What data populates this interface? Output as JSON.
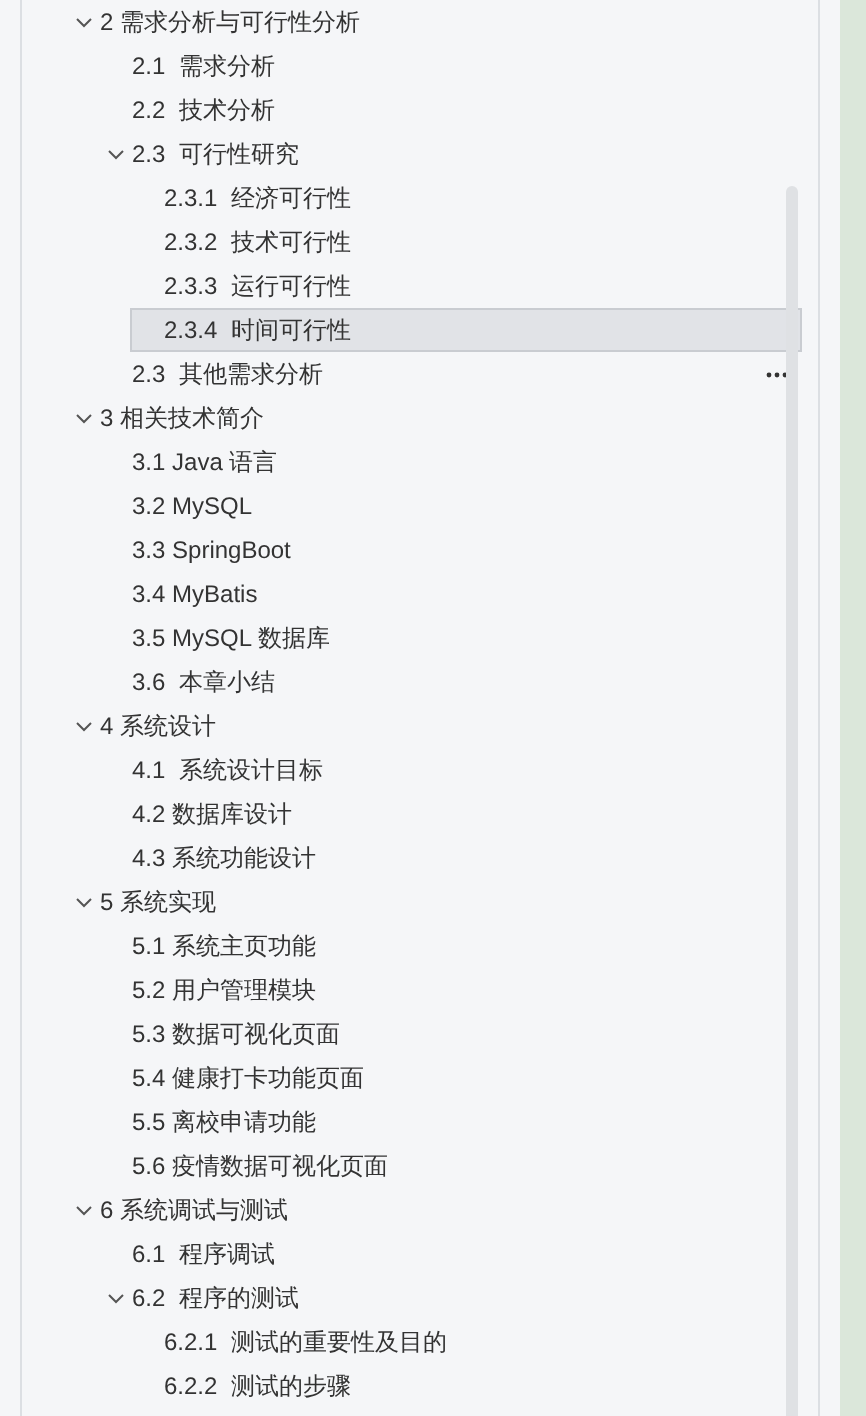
{
  "outline": [
    {
      "label": "2 需求分析与可行性分析",
      "expanded": true,
      "selected": false,
      "children": [
        {
          "label": "2.1  需求分析",
          "selected": false
        },
        {
          "label": "2.2  技术分析",
          "selected": false
        },
        {
          "label": "2.3  可行性研究",
          "expanded": true,
          "selected": false,
          "children": [
            {
              "label": "2.3.1  经济可行性",
              "selected": false
            },
            {
              "label": "2.3.2  技术可行性",
              "selected": false
            },
            {
              "label": "2.3.3  运行可行性",
              "selected": false
            },
            {
              "label": "2.3.4  时间可行性",
              "selected": true
            }
          ]
        },
        {
          "label": "2.3  其他需求分析",
          "selected": false,
          "hovered": true
        }
      ]
    },
    {
      "label": "3 相关技术简介",
      "expanded": true,
      "selected": false,
      "children": [
        {
          "label": "3.1 Java 语言",
          "selected": false
        },
        {
          "label": "3.2 MySQL",
          "selected": false
        },
        {
          "label": "3.3 SpringBoot",
          "selected": false
        },
        {
          "label": "3.4 MyBatis",
          "selected": false
        },
        {
          "label": "3.5 MySQL 数据库",
          "selected": false
        },
        {
          "label": "3.6  本章小结",
          "selected": false
        }
      ]
    },
    {
      "label": "4 系统设计",
      "expanded": true,
      "selected": false,
      "children": [
        {
          "label": "4.1  系统设计目标",
          "selected": false
        },
        {
          "label": "4.2 数据库设计",
          "selected": false
        },
        {
          "label": "4.3 系统功能设计",
          "selected": false
        }
      ]
    },
    {
      "label": "5 系统实现",
      "expanded": true,
      "selected": false,
      "children": [
        {
          "label": "5.1 系统主页功能",
          "selected": false
        },
        {
          "label": "5.2 用户管理模块",
          "selected": false
        },
        {
          "label": "5.3 数据可视化页面",
          "selected": false
        },
        {
          "label": "5.4 健康打卡功能页面",
          "selected": false
        },
        {
          "label": "5.5 离校申请功能",
          "selected": false
        },
        {
          "label": "5.6 疫情数据可视化页面",
          "selected": false
        }
      ]
    },
    {
      "label": "6 系统调试与测试",
      "expanded": true,
      "selected": false,
      "children": [
        {
          "label": "6.1  程序调试",
          "selected": false
        },
        {
          "label": "6.2  程序的测试",
          "expanded": true,
          "selected": false,
          "children": [
            {
              "label": "6.2.1  测试的重要性及目的",
              "selected": false
            },
            {
              "label": "6.2.2  测试的步骤",
              "selected": false
            }
          ]
        }
      ]
    }
  ]
}
